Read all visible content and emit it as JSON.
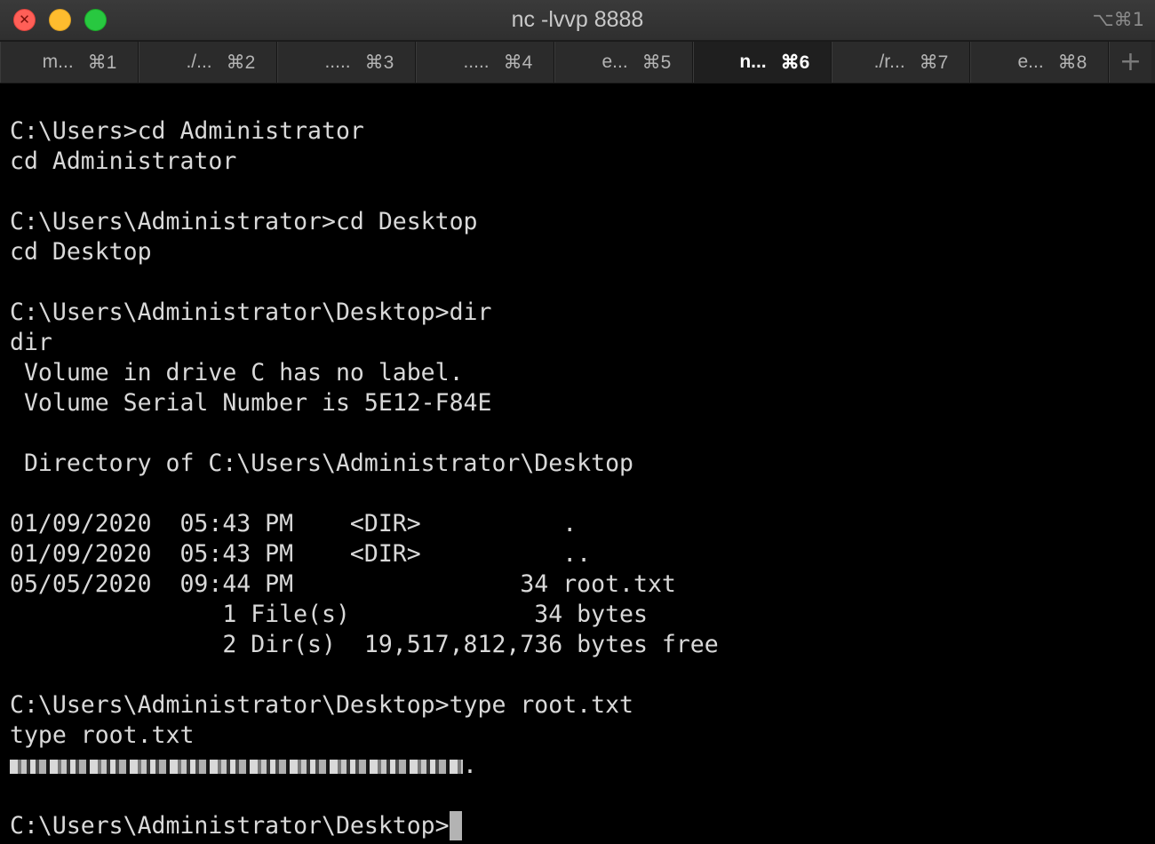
{
  "window": {
    "title": "nc -lvvp 8888",
    "shortcut": "⌥⌘1",
    "close_glyph": "✕"
  },
  "tabs": [
    {
      "label": "m...",
      "key": "⌘1",
      "active": false
    },
    {
      "label": "./...",
      "key": "⌘2",
      "active": false
    },
    {
      "label": ".....",
      "key": "⌘3",
      "active": false
    },
    {
      "label": ".....",
      "key": "⌘4",
      "active": false
    },
    {
      "label": "e...",
      "key": "⌘5",
      "active": false
    },
    {
      "label": "n...",
      "key": "⌘6",
      "active": true
    },
    {
      "label": "./r...",
      "key": "⌘7",
      "active": false
    },
    {
      "label": "e...",
      "key": "⌘8",
      "active": false
    }
  ],
  "new_tab_glyph": "+",
  "terminal": {
    "lines": [
      "C:\\Users>cd Administrator",
      "cd Administrator",
      "",
      "C:\\Users\\Administrator>cd Desktop",
      "cd Desktop",
      "",
      "C:\\Users\\Administrator\\Desktop>dir",
      "dir",
      " Volume in drive C has no label.",
      " Volume Serial Number is 5E12-F84E",
      "",
      " Directory of C:\\Users\\Administrator\\Desktop",
      "",
      "01/09/2020  05:43 PM    <DIR>          .",
      "01/09/2020  05:43 PM    <DIR>          ..",
      "05/05/2020  09:44 PM                34 root.txt",
      "               1 File(s)             34 bytes",
      "               2 Dir(s)  19,517,812,736 bytes free",
      "",
      "C:\\Users\\Administrator\\Desktop>type root.txt",
      "type root.txt"
    ],
    "redacted_output_suffix": ".",
    "prompt": "C:\\Users\\Administrator\\Desktop>"
  }
}
